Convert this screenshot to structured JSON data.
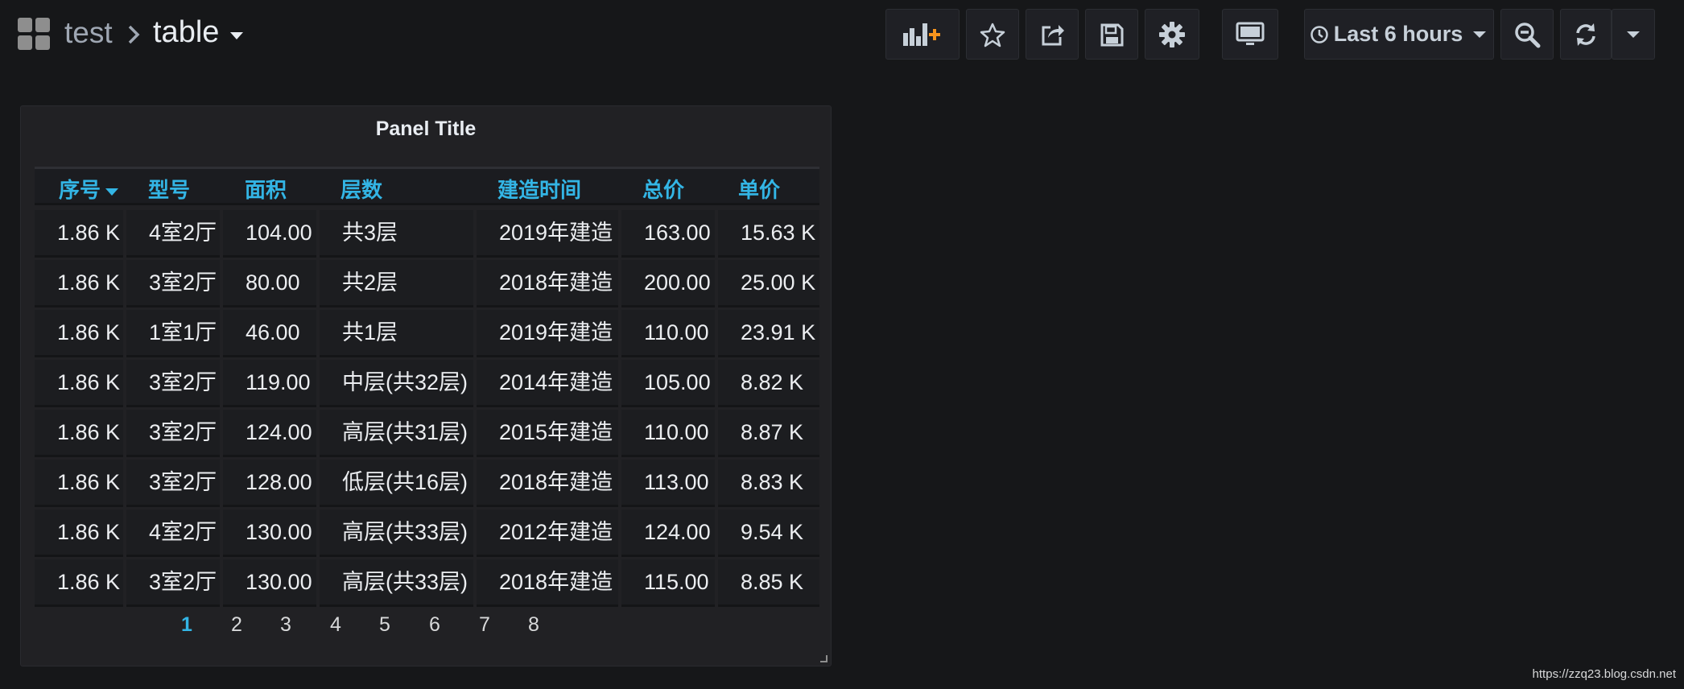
{
  "breadcrumb": {
    "folder": "test",
    "dashboard": "table"
  },
  "toolbar": {
    "time_range": "Last 6 hours"
  },
  "panel": {
    "title": "Panel Title",
    "columns": [
      "序号",
      "型号",
      "面积",
      "层数",
      "建造时间",
      "总价",
      "单价"
    ],
    "rows": [
      [
        "1.86 K",
        "4室2厅",
        "104.00",
        "共3层",
        "2019年建造",
        "163.00",
        "15.63 K"
      ],
      [
        "1.86 K",
        "3室2厅",
        "80.00",
        "共2层",
        "2018年建造",
        "200.00",
        "25.00 K"
      ],
      [
        "1.86 K",
        "1室1厅",
        "46.00",
        "共1层",
        "2019年建造",
        "110.00",
        "23.91 K"
      ],
      [
        "1.86 K",
        "3室2厅",
        "119.00",
        "中层(共32层)",
        "2014年建造",
        "105.00",
        "8.82 K"
      ],
      [
        "1.86 K",
        "3室2厅",
        "124.00",
        "高层(共31层)",
        "2015年建造",
        "110.00",
        "8.87 K"
      ],
      [
        "1.86 K",
        "3室2厅",
        "128.00",
        "低层(共16层)",
        "2018年建造",
        "113.00",
        "8.83 K"
      ],
      [
        "1.86 K",
        "4室2厅",
        "130.00",
        "高层(共33层)",
        "2012年建造",
        "124.00",
        "9.54 K"
      ],
      [
        "1.86 K",
        "3室2厅",
        "130.00",
        "高层(共33层)",
        "2018年建造",
        "115.00",
        "8.85 K"
      ]
    ],
    "pages": [
      "1",
      "2",
      "3",
      "4",
      "5",
      "6",
      "7",
      "8"
    ],
    "active_page": "1"
  },
  "watermark": "https://zzq23.blog.csdn.net",
  "colors": {
    "background": "#161719",
    "panel": "#212124",
    "accent": "#33b5e5",
    "add_panel_plus": "#f7941d"
  },
  "icons": {
    "dashboard": "grid-icon",
    "add_panel": "bar-chart-plus-icon",
    "star": "star-icon",
    "share": "share-icon",
    "save": "save-icon",
    "settings": "gear-icon",
    "tv_mode": "monitor-icon",
    "clock": "clock-icon",
    "zoom_out": "zoom-out-icon",
    "refresh": "refresh-icon",
    "refresh_menu": "caret-down-icon"
  }
}
